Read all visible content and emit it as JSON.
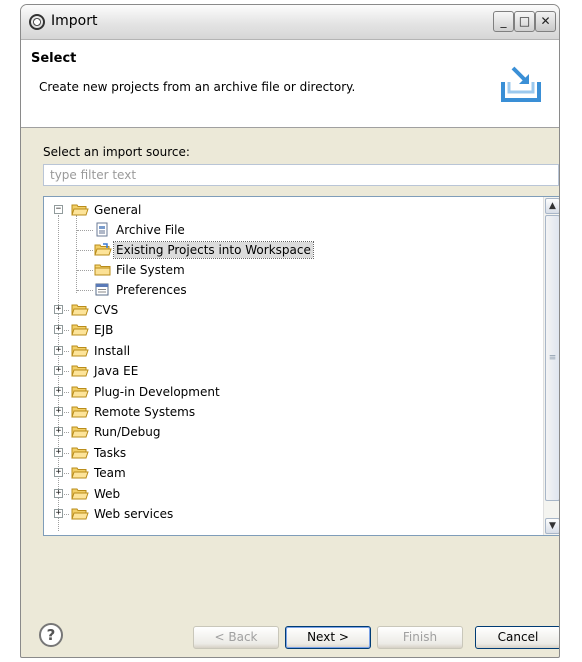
{
  "window": {
    "title": "Import",
    "minimize_glyph": "_",
    "maximize_glyph": "□",
    "close_glyph": "✕"
  },
  "header": {
    "title": "Select",
    "description": "Create new projects from an archive file or directory."
  },
  "source": {
    "label": "Select an import source:",
    "filter_placeholder": "type filter text"
  },
  "tree": {
    "general": {
      "label": "General",
      "expanded": true,
      "children": [
        {
          "label": "Archive File",
          "icon": "archive-file-icon"
        },
        {
          "label": "Existing Projects into Workspace",
          "icon": "project-folder-icon",
          "selected": true
        },
        {
          "label": "File System",
          "icon": "folder-icon"
        },
        {
          "label": "Preferences",
          "icon": "preferences-icon"
        }
      ]
    },
    "collapsed": [
      {
        "label": "CVS"
      },
      {
        "label": "EJB"
      },
      {
        "label": "Install"
      },
      {
        "label": "Java EE"
      },
      {
        "label": "Plug-in Development"
      },
      {
        "label": "Remote Systems"
      },
      {
        "label": "Run/Debug"
      },
      {
        "label": "Tasks"
      },
      {
        "label": "Team"
      },
      {
        "label": "Web"
      },
      {
        "label": "Web services"
      }
    ]
  },
  "buttons": {
    "back": "< Back",
    "next": "Next >",
    "finish": "Finish",
    "cancel": "Cancel"
  },
  "colors": {
    "selection": "#dcdcdc",
    "folder": "#f5d36e",
    "dialog": "#ece9d8"
  }
}
